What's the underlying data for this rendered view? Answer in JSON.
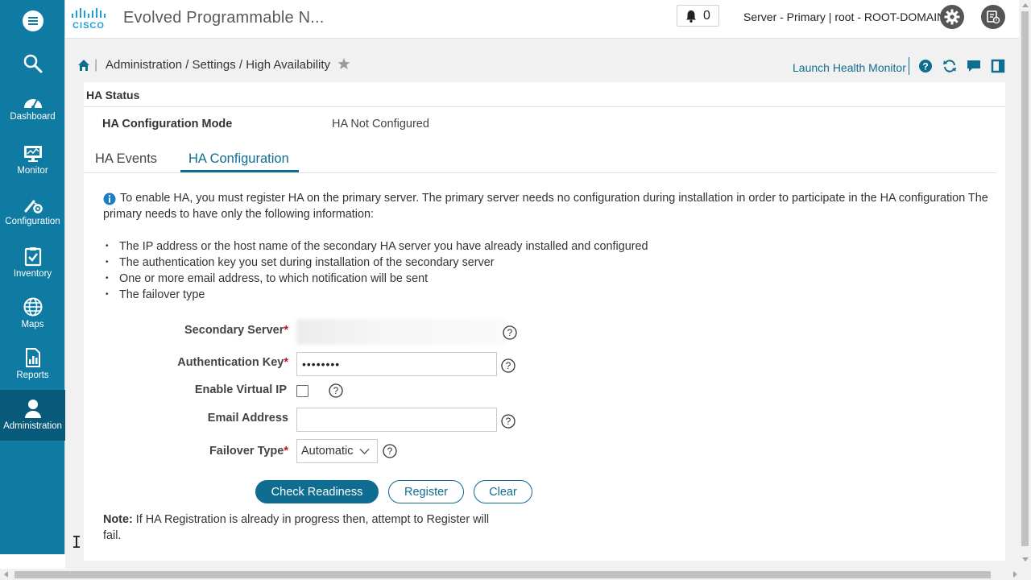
{
  "app": {
    "title": "Evolved Programmable N...",
    "logo_text": "CISCO",
    "alarm_count": "0",
    "server_info": "Server - Primary | root - ROOT-DOMAIN"
  },
  "sidebar": {
    "items": [
      {
        "label": "Dashboard",
        "icon": "dashboard-icon"
      },
      {
        "label": "Monitor",
        "icon": "monitor-icon"
      },
      {
        "label": "Configuration",
        "icon": "configuration-icon"
      },
      {
        "label": "Inventory",
        "icon": "inventory-icon"
      },
      {
        "label": "Maps",
        "icon": "globe-icon"
      },
      {
        "label": "Reports",
        "icon": "reports-icon"
      },
      {
        "label": "Administration",
        "icon": "user-icon",
        "active": true
      }
    ]
  },
  "breadcrumb": {
    "text": "Administration / Settings / High Availability",
    "health_link": "Launch Health Monitor"
  },
  "ha_status": {
    "title": "HA Status",
    "mode_label": "HA Configuration Mode",
    "mode_value": "HA Not Configured"
  },
  "tabs": [
    {
      "label": "HA Events",
      "active": false
    },
    {
      "label": "HA Configuration",
      "active": true
    }
  ],
  "info": {
    "text": "To enable HA, you must register HA on the primary server. The primary server needs no configuration during installation in order to participate in the HA configuration The primary needs to have only the following information:",
    "bullets": [
      "The IP address or the host name of the secondary HA server you have already installed and configured",
      "The authentication key you set during installation of the secondary server",
      "One or more email address, to which notification will be sent",
      "The failover type"
    ]
  },
  "form": {
    "secondary_server_label": "Secondary Server",
    "auth_key_label": "Authentication Key",
    "auth_key_value": "••••••••",
    "virtual_ip_label": "Enable Virtual IP",
    "email_label": "Email Address",
    "email_value": "",
    "failover_label": "Failover Type",
    "failover_value": "Automatic",
    "required_mark": "*"
  },
  "buttons": {
    "check_readiness": "Check Readiness",
    "register": "Register",
    "clear": "Clear"
  },
  "note": {
    "bold": "Note:",
    "text": " If HA Registration is already in progress then, attempt to Register will fail."
  },
  "colors": {
    "sidebar": "#0f7ba3",
    "sidebar_active": "#075a7a",
    "accent": "#0f6d92",
    "required": "#c0102a"
  }
}
